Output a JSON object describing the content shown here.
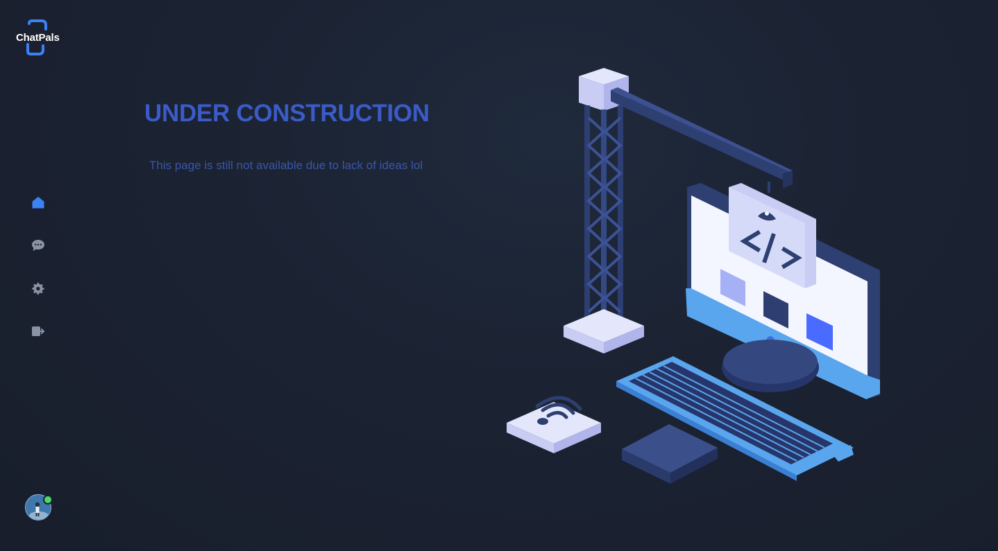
{
  "app": {
    "logo_text": "ChatPals"
  },
  "sidebar": {
    "items": [
      {
        "name": "home",
        "icon": "home-icon",
        "active": true
      },
      {
        "name": "chats",
        "icon": "chat-bubble-icon",
        "active": false
      },
      {
        "name": "settings",
        "icon": "gear-icon",
        "active": false
      },
      {
        "name": "logout",
        "icon": "logout-icon",
        "active": false
      }
    ],
    "user": {
      "status": "online"
    }
  },
  "main": {
    "title": "UNDER CONSTRUCTION",
    "subtitle": "This page is still not available due to lack of ideas lol"
  },
  "colors": {
    "background": "#1a2130",
    "accent": "#3b5bc7",
    "nav_active": "#3b82f6",
    "nav_inactive": "#8a93a3",
    "status_online": "#4cd964"
  }
}
